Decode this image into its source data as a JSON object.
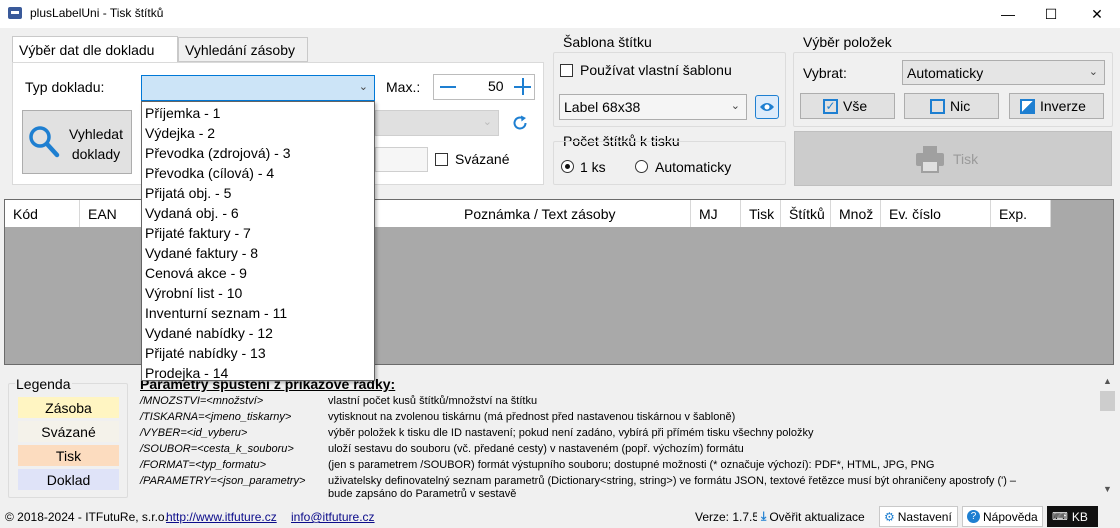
{
  "window": {
    "title": "plusLabelUni - Tisk štítků",
    "minimize": "—",
    "maximize": "☐",
    "close": "✕"
  },
  "tabs": [
    {
      "label": "Výběr dat dle dokladu",
      "active": true
    },
    {
      "label": "Vyhledání zásoby",
      "active": false
    }
  ],
  "document_panel": {
    "doc_type_label": "Typ dokladu:",
    "doc_type_value": "",
    "max_label": "Max.:",
    "max_value": "50",
    "search_button": "Vyhledat\ndoklady",
    "search_button_line1": "Vyhledat",
    "search_button_line2": "doklady",
    "bound_label": "Svázané"
  },
  "doc_type_options": [
    "Příjemka - 1",
    "Výdejka - 2",
    "Převodka (zdrojová) - 3",
    "Převodka (cílová) - 4",
    "Přijatá obj. - 5",
    "Vydaná obj. - 6",
    "Přijaté faktury - 7",
    "Vydané faktury - 8",
    "Cenová akce - 9",
    "Výrobní list - 10",
    "Inventurní seznam - 11",
    "Vydané nabídky - 12",
    "Přijaté nabídky - 13",
    "Prodejka - 14"
  ],
  "template": {
    "title": "Šablona štítku",
    "use_own_label": "Používat vlastní šablonu",
    "template_value": "Label 68x38"
  },
  "count": {
    "title": "Počet štítků k tisku",
    "option1": "1 ks",
    "option2": "Automaticky"
  },
  "selection": {
    "title": "Výběr položek",
    "select_label": "Vybrat:",
    "select_value": "Automaticky",
    "all_button": "Vše",
    "none_button": "Nic",
    "invert_button": "Inverze",
    "print_button": "Tisk"
  },
  "grid_columns": [
    "Kód",
    "EAN",
    "Poznámka / Text zásoby",
    "MJ",
    "Tisk",
    "Štítků",
    "Množ",
    "Ev. číslo",
    "Exp."
  ],
  "legend": {
    "title": "Legenda",
    "items": [
      {
        "label": "Zásoba",
        "color": "#fff5c2"
      },
      {
        "label": "Svázané",
        "color": "#f4f2ea"
      },
      {
        "label": "Tisk",
        "color": "#fcdcbf"
      },
      {
        "label": "Doklad",
        "color": "#dfe3f8"
      }
    ]
  },
  "params": {
    "title": "Parametry spuštění z příkazové řádky:",
    "rows": [
      {
        "param": "/MNOZSTVI=<množství>",
        "desc": "vlastní počet kusů štítků/množství na štítku"
      },
      {
        "param": "/TISKARNA=<jmeno_tiskarny>",
        "desc": "vytisknout na zvolenou tiskárnu (má přednost před nastavenou tiskárnou v šabloně)"
      },
      {
        "param": "/VYBER=<id_vyberu>",
        "desc": "výběr položek k tisku dle ID nastavení; pokud není zadáno, vybírá při přímém tisku všechny položky"
      },
      {
        "param": "/SOUBOR=<cesta_k_souboru>",
        "desc": "uloží sestavu do souboru (vč. předané cesty) v nastaveném (popř. výchozím) formátu"
      },
      {
        "param": "/FORMAT=<typ_formatu>",
        "desc": "(jen s parametrem /SOUBOR) formát výstupního souboru; dostupné možnosti (* označuje výchozí): PDF*, HTML, JPG, PNG"
      },
      {
        "param": "/PARAMETRY=<json_parametry>",
        "desc": "uživatelsky definovatelný seznam parametrů (Dictionary<string, string>) ve formátu JSON, textové řetězce musí být ohraničeny apostrofy (') –"
      },
      {
        "param": "",
        "desc": "bude zapsáno do Parametrů v sestavě"
      }
    ]
  },
  "status": {
    "copyright": "© 2018-2024 - ITFutuRe, s.r.o.",
    "web_link": "http://www.itfuture.cz",
    "mail_link": "info@itfuture.cz",
    "version": "Verze: 1.7.5",
    "update_button": "Ověřit aktualizace",
    "settings_button": "Nastavení",
    "help_button": "Nápověda",
    "kb_button": "KB"
  },
  "colors": {
    "accent": "#1e7fd1",
    "grid_bg": "#a9a9a9",
    "dropdown_field": "#cce4f7"
  }
}
